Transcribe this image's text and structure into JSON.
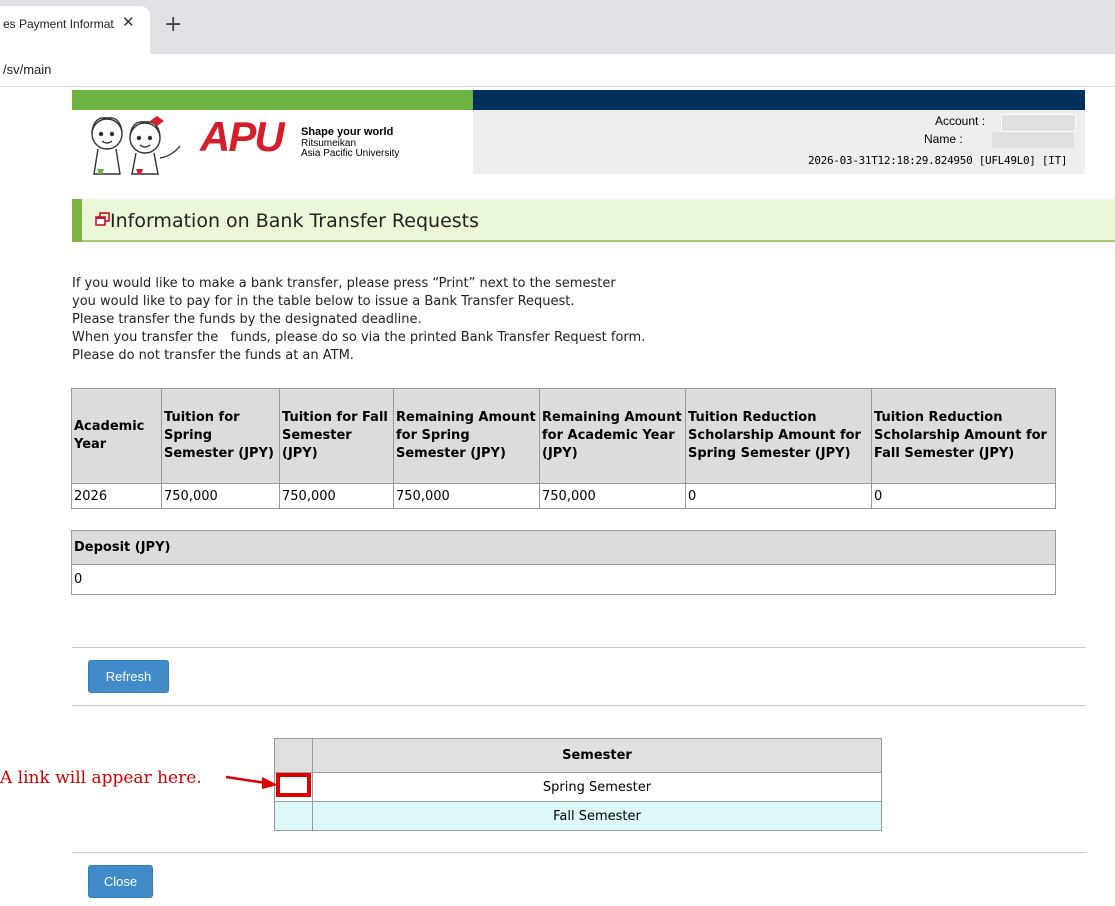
{
  "browser": {
    "tab_title": "es Payment Informat",
    "tab_close": "✕",
    "new_tab": "+",
    "url": "/sv/main"
  },
  "header": {
    "logo_text": "APU",
    "slogan": "Shape your world",
    "university_line1": "Ritsumeikan",
    "university_line2": "Asia Pacific University",
    "account_label": "Account :",
    "name_label": "Name :",
    "timestamp": "2026-03-31T12:18:29.824950 [UFL49L0] [IT]"
  },
  "section": {
    "title": "Information on Bank Transfer Requests",
    "instructions": [
      "If you would like to make a bank transfer, please press “Print” next to the semester",
      "you would like to pay for in the table below to issue a Bank Transfer Request.",
      "Please transfer the funds by the designated deadline.",
      "When you transfer the   funds, please do so via the printed Bank Transfer Request form.",
      "Please do not transfer the funds at an ATM."
    ]
  },
  "tuition_table": {
    "headers": [
      "Academic Year",
      "Tuition for Spring Semester (JPY)",
      "Tuition for Fall Semester (JPY)",
      "Remaining Amount for Spring Semester (JPY)",
      "Remaining Amount for Academic Year (JPY)",
      "Tuition Reduction Scholarship Amount for Spring Semester (JPY)",
      "Tuition Reduction Scholarship Amount for Fall Semester (JPY)"
    ],
    "rows": [
      [
        "2026",
        "750,000",
        "750,000",
        "750,000",
        "750,000",
        "0",
        "0"
      ]
    ]
  },
  "deposit_table": {
    "header": "Deposit (JPY)",
    "value": "0"
  },
  "buttons": {
    "refresh": "Refresh",
    "close": "Close"
  },
  "semester_table": {
    "header": "Semester",
    "rows": [
      "Spring Semester",
      "Fall Semester"
    ]
  },
  "annotation": {
    "text": "A link will appear here.",
    "color": "#d40000"
  }
}
